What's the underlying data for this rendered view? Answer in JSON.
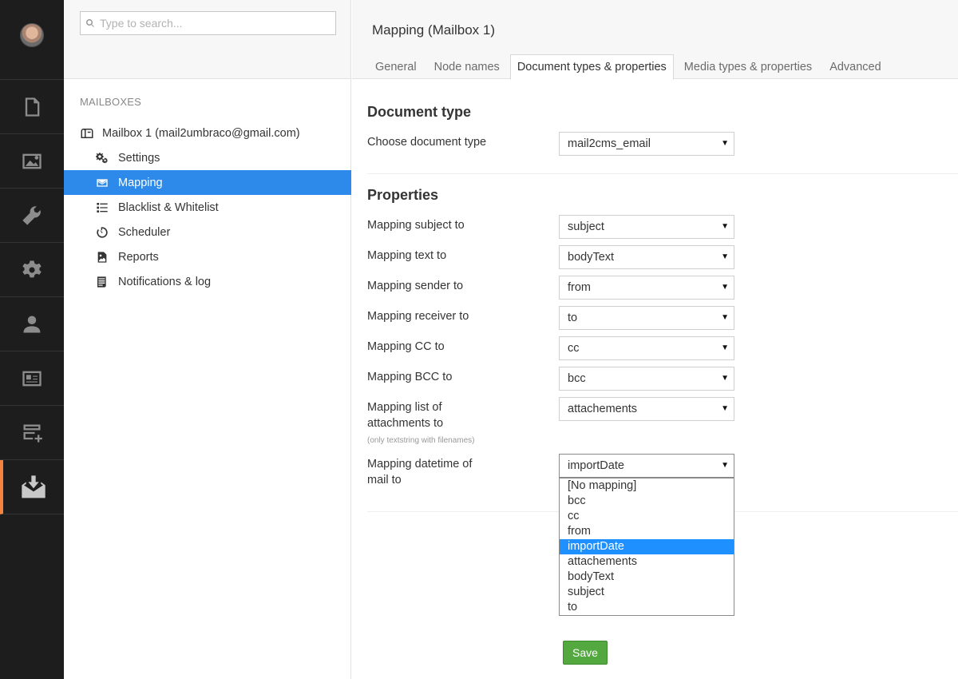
{
  "search": {
    "placeholder": "Type to search..."
  },
  "tree": {
    "section_title": "MAILBOXES",
    "root_label": "Mailbox 1 (mail2umbraco@gmail.com)",
    "items": [
      {
        "label": "Settings",
        "icon": "settings-icon"
      },
      {
        "label": "Mapping",
        "icon": "envelope-icon",
        "selected": true
      },
      {
        "label": "Blacklist & Whitelist",
        "icon": "list-icon"
      },
      {
        "label": "Scheduler",
        "icon": "timer-icon"
      },
      {
        "label": "Reports",
        "icon": "chart-document-icon"
      },
      {
        "label": "Notifications & log",
        "icon": "log-document-icon"
      }
    ]
  },
  "header": {
    "title": "Mapping (Mailbox 1)",
    "tabs": [
      "General",
      "Node names",
      "Document types & properties",
      "Media types & properties",
      "Advanced"
    ],
    "active_tab": "Document types & properties"
  },
  "document_type": {
    "heading": "Document type",
    "label": "Choose document type",
    "value": "mail2cms_email"
  },
  "properties": {
    "heading": "Properties",
    "rows": [
      {
        "label": "Mapping subject to",
        "value": "subject"
      },
      {
        "label": "Mapping text to",
        "value": "bodyText"
      },
      {
        "label": "Mapping sender to",
        "value": "from"
      },
      {
        "label": "Mapping receiver to",
        "value": "to"
      },
      {
        "label": "Mapping CC to",
        "value": "cc"
      },
      {
        "label": "Mapping BCC to",
        "value": "bcc"
      },
      {
        "label": "Mapping list of attachments to",
        "note": "(only textstring with filenames)",
        "value": "attachements"
      },
      {
        "label": "Mapping datetime of mail to",
        "value": "importDate"
      }
    ]
  },
  "dropdown": {
    "options": [
      "[No mapping]",
      "bcc",
      "cc",
      "from",
      "importDate",
      "attachements",
      "bodyText",
      "subject",
      "to"
    ],
    "highlighted": "importDate"
  },
  "save_label": "Save",
  "colors": {
    "accent": "#2e8aea",
    "active_section": "#f5853e",
    "save": "#53a93f",
    "sidebar_bg": "#1d1d1d"
  }
}
